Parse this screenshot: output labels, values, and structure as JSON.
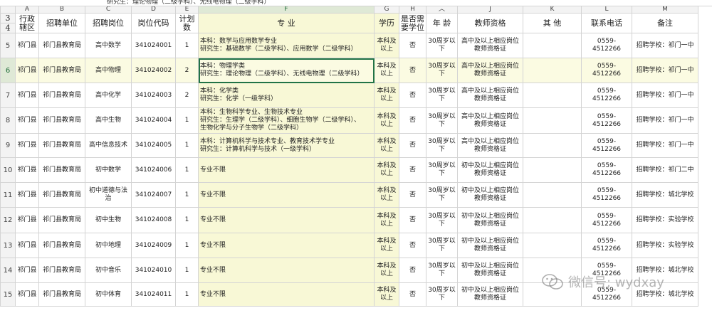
{
  "formula_bar": {
    "value": "研究生：理论物理（二级学科）、无线电物理（二级学科）"
  },
  "columns": [
    "A",
    "B",
    "C",
    "D",
    "E",
    "F",
    "G",
    "H",
    "",
    "J",
    "K",
    "L",
    "M"
  ],
  "row_numbers": {
    "r3": "3",
    "r4": "4"
  },
  "headers": {
    "region": "行政辖区",
    "unit": "招聘单位",
    "position": "招聘岗位",
    "code": "岗位代码",
    "plan": "计划数",
    "major": "专 业",
    "education": "学历",
    "degree": "是否需要学位",
    "age": "年 龄",
    "qualification": "教师资格",
    "other": "其 他",
    "phone": "联系电话",
    "note": "备注"
  },
  "rows": [
    {
      "num": "5",
      "region": "祁门县",
      "unit": "祁门县教育局",
      "position": "高中数学",
      "code": "341024001",
      "plan": "1",
      "major": [
        "本科：数学与应用数学专业",
        "研究生：基础数学（二级学科）、应用数学（二级学科）"
      ],
      "education": "本科及以上",
      "degree": "否",
      "age": "30周岁以下",
      "qualification": "高中及以上相应岗位教师资格证",
      "other": "",
      "phone": "0559-4512266",
      "note": "招聘学校：祁门一中"
    },
    {
      "num": "6",
      "region": "祁门县",
      "unit": "祁门县教育局",
      "position": "高中物理",
      "code": "341024002",
      "plan": "2",
      "major": [
        "本科：物理学类",
        "研究生：理论物理（二级学科）、无线电物理（二级学科）"
      ],
      "education": "本科及以上",
      "degree": "否",
      "age": "30周岁以下",
      "qualification": "高中及以上相应岗位教师资格证",
      "other": "",
      "phone": "0559-4512266",
      "note": "招聘学校：祁门一中"
    },
    {
      "num": "7",
      "region": "祁门县",
      "unit": "祁门县教育局",
      "position": "高中化学",
      "code": "341024003",
      "plan": "2",
      "major": [
        "本科：化学类",
        "研究生：化学（一级学科）"
      ],
      "education": "本科及以上",
      "degree": "否",
      "age": "30周岁以下",
      "qualification": "高中及以上相应岗位教师资格证",
      "other": "",
      "phone": "0559-4512266",
      "note": "招聘学校：祁门一中"
    },
    {
      "num": "8",
      "region": "祁门县",
      "unit": "祁门县教育局",
      "position": "高中生物",
      "code": "341024004",
      "plan": "1",
      "major": [
        "本科：生物科学专业、生物技术专业",
        "研究生：生理学（二级学科）、细胞生物学（二级学科）、",
        "生物化学与分子生物学（二级学科）"
      ],
      "education": "本科及以上",
      "degree": "否",
      "age": "30周岁以下",
      "qualification": "高中及以上相应岗位教师资格证",
      "other": "",
      "phone": "0559-4512266",
      "note": "招聘学校：祁门一中"
    },
    {
      "num": "9",
      "region": "祁门县",
      "unit": "祁门县教育局",
      "position": "高中信息技术",
      "code": "341024005",
      "plan": "1",
      "major": [
        "本科：计算机科学与技术专业、教育技术学专业",
        "研究生：计算机科学与技术（一级学科）"
      ],
      "education": "本科及以上",
      "degree": "否",
      "age": "30周岁以下",
      "qualification": "高中及以上相应岗位教师资格证",
      "other": "",
      "phone": "0559-4512266",
      "note": "招聘学校：祁门一中"
    },
    {
      "num": "10",
      "region": "祁门县",
      "unit": "祁门县教育局",
      "position": "初中数学",
      "code": "341024006",
      "plan": "1",
      "major": [
        "专业不限"
      ],
      "education": "本科及以上",
      "degree": "否",
      "age": "30周岁以下",
      "qualification": "初中及以上相应岗位教师资格证",
      "other": "",
      "phone": "0559-4512266",
      "note": "招聘学校：祁门二中"
    },
    {
      "num": "11",
      "region": "祁门县",
      "unit": "祁门县教育局",
      "position": "初中道德与法治",
      "code": "341024007",
      "plan": "1",
      "major": [
        "专业不限"
      ],
      "education": "本科及以上",
      "degree": "否",
      "age": "30周岁以下",
      "qualification": "初中及以上相应岗位教师资格证",
      "other": "",
      "phone": "0559-4512266",
      "note": "招聘学校：城北学校"
    },
    {
      "num": "12",
      "region": "祁门县",
      "unit": "祁门县教育局",
      "position": "初中生物",
      "code": "341024008",
      "plan": "1",
      "major": [
        "专业不限"
      ],
      "education": "本科及以上",
      "degree": "否",
      "age": "30周岁以下",
      "qualification": "初中及以上相应岗位教师资格证",
      "other": "",
      "phone": "0559-4512266",
      "note": "招聘学校：实验学校"
    },
    {
      "num": "13",
      "region": "祁门县",
      "unit": "祁门县教育局",
      "position": "初中地理",
      "code": "341024009",
      "plan": "1",
      "major": [
        "专业不限"
      ],
      "education": "本科及以上",
      "degree": "否",
      "age": "30周岁以下",
      "qualification": "初中及以上相应岗位教师资格证",
      "other": "",
      "phone": "0559-4512266",
      "note": "招聘学校：实验学校"
    },
    {
      "num": "14",
      "region": "祁门县",
      "unit": "祁门县教育局",
      "position": "初中音乐",
      "code": "341024010",
      "plan": "1",
      "major": [
        "专业不限"
      ],
      "education": "本科及以上",
      "degree": "否",
      "age": "30周岁以下",
      "qualification": "初中及以上相应岗位教师资格证",
      "other": "",
      "phone": "0559-4512266",
      "note": "招聘学校：城北学校"
    },
    {
      "num": "15",
      "region": "祁门县",
      "unit": "祁门县教育局",
      "position": "初中体育",
      "code": "341024011",
      "plan": "1",
      "major": [
        "专业不限"
      ],
      "education": "本科及以上",
      "degree": "否",
      "age": "30周岁以下",
      "qualification": "初中及以上相应岗位教师资格证",
      "other": "",
      "phone": "0559-4512266",
      "note": "招聘学校：城北学校"
    }
  ],
  "selected_row_index": 1,
  "watermark": {
    "text": "微信号: wydxay",
    "icon": "wechat-icon"
  }
}
